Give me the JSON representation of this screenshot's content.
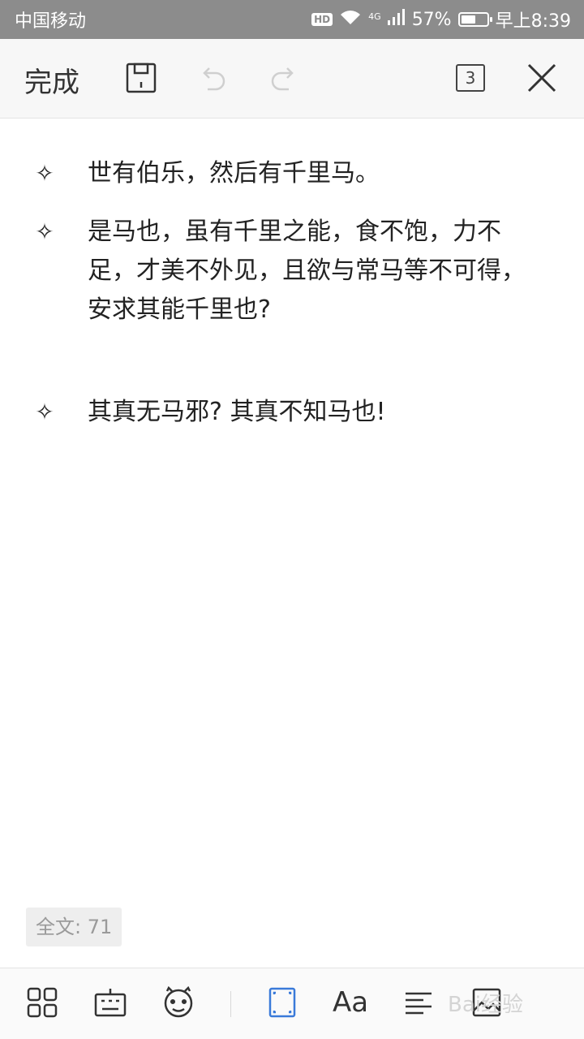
{
  "status": {
    "carrier": "中国移动",
    "hd": "HD",
    "network": "4G",
    "battery_text": "57%",
    "battery_level": 0.57,
    "time": "早上8:39"
  },
  "toolbar": {
    "done_label": "完成",
    "page_count": "3",
    "icons": [
      "save-icon",
      "undo-icon",
      "redo-icon",
      "close-icon"
    ]
  },
  "document": {
    "bullet_glyph": "✧",
    "items": [
      {
        "lines": [
          "世有伯乐，然后有千里马。"
        ]
      },
      {
        "lines": [
          "是马也，虽有千里之能，食不饱，力不",
          "足，才美不外见，且欲与常马等不可得，",
          "安求其能千里也?"
        ]
      },
      {
        "lines": [
          "其真无马邪? 其真不知马也!"
        ]
      }
    ]
  },
  "wordcount": {
    "label": "全文: 71"
  },
  "bottombar": {
    "font_label": "Aa",
    "watermark": "Bai经验",
    "icons": [
      "apps-icon",
      "keyboard-icon",
      "emoji-icon",
      "frame-icon",
      "font-icon",
      "align-icon",
      "image-icon"
    ],
    "active_color": "#3a7ad9"
  }
}
